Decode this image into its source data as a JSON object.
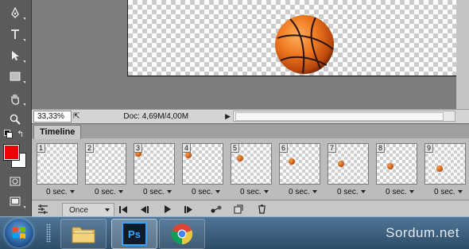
{
  "tools": {
    "items": [
      "pen-tool",
      "type-tool",
      "path-selection-tool",
      "rectangle-tool",
      "hand-tool",
      "zoom-tool",
      "swap-colors-icon",
      "quick-mask-icon",
      "screen-mode-icon"
    ],
    "foreground_color": "#f00000",
    "background_color": "#ffffff"
  },
  "status": {
    "zoom": "33,33%",
    "doc": "Doc: 4,69M/4,00M"
  },
  "timeline": {
    "tab_label": "Timeline",
    "frames": [
      {
        "number": "1",
        "delay": "0 sec."
      },
      {
        "number": "2",
        "delay": "0 sec."
      },
      {
        "number": "3",
        "delay": "0 sec."
      },
      {
        "number": "4",
        "delay": "0 sec."
      },
      {
        "number": "5",
        "delay": "0 sec."
      },
      {
        "number": "6",
        "delay": "0 sec."
      },
      {
        "number": "7",
        "delay": "0 sec."
      },
      {
        "number": "8",
        "delay": "0 sec."
      },
      {
        "number": "9",
        "delay": "0 sec."
      }
    ],
    "loop_option": "Once"
  },
  "taskbar": {
    "apps": [
      "windows-explorer",
      "photoshop",
      "chrome"
    ],
    "ps_label": "Ps",
    "watermark": "Sordum.net"
  }
}
